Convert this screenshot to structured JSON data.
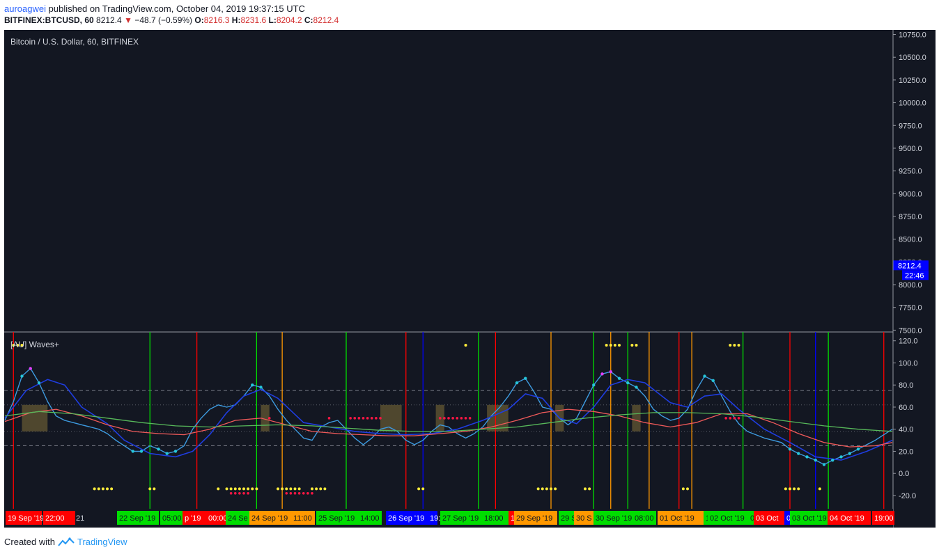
{
  "header": {
    "user": "auroagwei",
    "published": "published on TradingView.com, October 04, 2019 19:37:15 UTC",
    "symbol": "BITFINEX:BTCUSD, 60",
    "last": "8212.4",
    "change": "−48.7 (−0.59%)",
    "o_label": "O:",
    "o": "8216.3",
    "h_label": "H:",
    "h": "8231.6",
    "l_label": "L:",
    "l": "8204.2",
    "c_label": "C:",
    "c": "8212.4"
  },
  "footer": {
    "created": "Created with",
    "brand": "TradingView"
  },
  "colors": {
    "background": "#131722",
    "price_tag": "#0000ff",
    "wave_fast": "#3d9be0",
    "wave_slow": "#1f3de0",
    "red_line": "#f05a5a",
    "green_line": "#57b85a",
    "overbought_dot": "#e040fb",
    "dot_cyan": "#26c6da",
    "dot_yellow": "#ffeb3b",
    "dot_red": "#ff1744",
    "vline_red": "#ff0000",
    "vline_green": "#00dd00",
    "vline_orange": "#ff9800",
    "vline_blue": "#0000ff",
    "zone": "#5a5030"
  },
  "chart_data": [
    {
      "type": "line",
      "title": "Bitcoin / U.S. Dollar, 60, BITFINEX",
      "ylim": [
        7480,
        10800
      ],
      "y_ticks": [
        "10750.0",
        "10500.0",
        "10250.0",
        "10000.0",
        "9750.0",
        "9500.0",
        "9250.0",
        "9000.0",
        "8750.0",
        "8500.0",
        "8250.0",
        "8000.0",
        "7750.0",
        "7500.0"
      ],
      "last_price": "8212.4",
      "countdown": "22:46",
      "series": []
    },
    {
      "type": "line",
      "title": "[AU] Waves+",
      "ylim": [
        -32,
        128
      ],
      "y_ticks": [
        "120.0",
        "100.0",
        "80.0",
        "60.0",
        "40.0",
        "20.0",
        "0.0",
        "-20.0"
      ],
      "ref_levels_dashed": [
        75,
        25
      ],
      "ref_levels_dotted": [
        62,
        38
      ],
      "x_count": 209,
      "series": [
        {
          "name": "wave_fast",
          "points": [
            [
              0,
              48
            ],
            [
              2,
              65
            ],
            [
              4,
              88
            ],
            [
              6,
              95
            ],
            [
              8,
              82
            ],
            [
              10,
              65
            ],
            [
              12,
              52
            ],
            [
              14,
              48
            ],
            [
              16,
              46
            ],
            [
              18,
              44
            ],
            [
              20,
              42
            ],
            [
              22,
              40
            ],
            [
              24,
              36
            ],
            [
              26,
              30
            ],
            [
              28,
              25
            ],
            [
              30,
              20
            ],
            [
              32,
              20
            ],
            [
              34,
              25
            ],
            [
              36,
              22
            ],
            [
              38,
              18
            ],
            [
              40,
              20
            ],
            [
              42,
              25
            ],
            [
              44,
              40
            ],
            [
              46,
              50
            ],
            [
              48,
              58
            ],
            [
              50,
              62
            ],
            [
              52,
              60
            ],
            [
              54,
              62
            ],
            [
              56,
              70
            ],
            [
              58,
              80
            ],
            [
              60,
              78
            ],
            [
              62,
              70
            ],
            [
              64,
              58
            ],
            [
              66,
              48
            ],
            [
              68,
              40
            ],
            [
              70,
              32
            ],
            [
              72,
              30
            ],
            [
              74,
              42
            ],
            [
              76,
              46
            ],
            [
              78,
              48
            ],
            [
              80,
              40
            ],
            [
              82,
              32
            ],
            [
              84,
              26
            ],
            [
              86,
              32
            ],
            [
              88,
              40
            ],
            [
              90,
              42
            ],
            [
              92,
              38
            ],
            [
              94,
              30
            ],
            [
              96,
              26
            ],
            [
              98,
              30
            ],
            [
              100,
              38
            ],
            [
              102,
              44
            ],
            [
              104,
              42
            ],
            [
              106,
              36
            ],
            [
              108,
              32
            ],
            [
              110,
              36
            ],
            [
              112,
              42
            ],
            [
              114,
              52
            ],
            [
              116,
              60
            ],
            [
              118,
              70
            ],
            [
              120,
              82
            ],
            [
              122,
              86
            ],
            [
              124,
              74
            ],
            [
              126,
              60
            ],
            [
              128,
              58
            ],
            [
              130,
              50
            ],
            [
              132,
              44
            ],
            [
              134,
              50
            ],
            [
              136,
              65
            ],
            [
              138,
              80
            ],
            [
              140,
              90
            ],
            [
              142,
              92
            ],
            [
              144,
              86
            ],
            [
              146,
              82
            ],
            [
              148,
              78
            ],
            [
              150,
              70
            ],
            [
              152,
              58
            ],
            [
              154,
              52
            ],
            [
              156,
              48
            ],
            [
              158,
              50
            ],
            [
              160,
              58
            ],
            [
              162,
              75
            ],
            [
              164,
              88
            ],
            [
              166,
              84
            ],
            [
              168,
              70
            ],
            [
              170,
              56
            ],
            [
              172,
              45
            ],
            [
              174,
              38
            ],
            [
              176,
              35
            ],
            [
              178,
              32
            ],
            [
              180,
              30
            ],
            [
              182,
              28
            ],
            [
              184,
              22
            ],
            [
              186,
              18
            ],
            [
              188,
              15
            ],
            [
              190,
              12
            ],
            [
              192,
              8
            ],
            [
              194,
              12
            ],
            [
              196,
              15
            ],
            [
              198,
              18
            ],
            [
              200,
              22
            ],
            [
              202,
              26
            ],
            [
              204,
              30
            ],
            [
              206,
              35
            ],
            [
              208,
              40
            ]
          ]
        },
        {
          "name": "wave_slow",
          "points": [
            [
              0,
              50
            ],
            [
              5,
              75
            ],
            [
              10,
              85
            ],
            [
              14,
              80
            ],
            [
              18,
              60
            ],
            [
              24,
              45
            ],
            [
              28,
              30
            ],
            [
              34,
              18
            ],
            [
              40,
              15
            ],
            [
              44,
              20
            ],
            [
              48,
              35
            ],
            [
              52,
              55
            ],
            [
              56,
              70
            ],
            [
              60,
              76
            ],
            [
              64,
              68
            ],
            [
              70,
              46
            ],
            [
              76,
              42
            ],
            [
              82,
              38
            ],
            [
              88,
              36
            ],
            [
              94,
              35
            ],
            [
              100,
              36
            ],
            [
              106,
              40
            ],
            [
              112,
              48
            ],
            [
              118,
              58
            ],
            [
              122,
              72
            ],
            [
              126,
              68
            ],
            [
              130,
              50
            ],
            [
              134,
              45
            ],
            [
              138,
              60
            ],
            [
              142,
              80
            ],
            [
              146,
              85
            ],
            [
              150,
              82
            ],
            [
              156,
              64
            ],
            [
              160,
              60
            ],
            [
              164,
              70
            ],
            [
              168,
              72
            ],
            [
              172,
              58
            ],
            [
              178,
              40
            ],
            [
              184,
              28
            ],
            [
              190,
              15
            ],
            [
              196,
              12
            ],
            [
              202,
              20
            ],
            [
              208,
              30
            ]
          ]
        },
        {
          "name": "red_line",
          "points": [
            [
              0,
              47
            ],
            [
              6,
              55
            ],
            [
              12,
              58
            ],
            [
              18,
              52
            ],
            [
              24,
              44
            ],
            [
              30,
              38
            ],
            [
              36,
              36
            ],
            [
              42,
              35
            ],
            [
              48,
              40
            ],
            [
              54,
              48
            ],
            [
              60,
              50
            ],
            [
              66,
              44
            ],
            [
              72,
              38
            ],
            [
              78,
              36
            ],
            [
              84,
              35
            ],
            [
              90,
              34
            ],
            [
              96,
              34
            ],
            [
              102,
              36
            ],
            [
              108,
              38
            ],
            [
              114,
              42
            ],
            [
              120,
              48
            ],
            [
              126,
              55
            ],
            [
              132,
              58
            ],
            [
              138,
              56
            ],
            [
              144,
              52
            ],
            [
              150,
              46
            ],
            [
              156,
              42
            ],
            [
              162,
              46
            ],
            [
              168,
              54
            ],
            [
              174,
              54
            ],
            [
              180,
              46
            ],
            [
              186,
              36
            ],
            [
              192,
              28
            ],
            [
              198,
              24
            ],
            [
              204,
              25
            ],
            [
              208,
              28
            ]
          ]
        },
        {
          "name": "green_line",
          "points": [
            [
              0,
              52
            ],
            [
              8,
              56
            ],
            [
              16,
              54
            ],
            [
              24,
              50
            ],
            [
              32,
              46
            ],
            [
              40,
              43
            ],
            [
              48,
              42
            ],
            [
              56,
              43
            ],
            [
              64,
              44
            ],
            [
              72,
              43
            ],
            [
              80,
              41
            ],
            [
              88,
              39
            ],
            [
              96,
              38
            ],
            [
              104,
              38
            ],
            [
              112,
              40
            ],
            [
              120,
              42
            ],
            [
              128,
              46
            ],
            [
              136,
              50
            ],
            [
              144,
              53
            ],
            [
              152,
              55
            ],
            [
              160,
              55
            ],
            [
              168,
              54
            ],
            [
              176,
              51
            ],
            [
              184,
              47
            ],
            [
              192,
              43
            ],
            [
              200,
              40
            ],
            [
              208,
              38
            ]
          ]
        }
      ],
      "x_labels": [
        "19 Sep '19",
        "22:00",
        "21",
        "22 Sep '19",
        "05:00",
        "p '19",
        "00:00",
        "24 Se",
        "24 Sep '19",
        "11:00",
        "25 Sep '19",
        "14:00",
        "26 Sep '19",
        "19:",
        "27 Sep '19",
        "18:00",
        "1:",
        "29 Sep '19",
        "29 S",
        "30 S",
        "30 Sep '19",
        "08:00",
        "01 Oct '19",
        "1",
        "02 Oct '19",
        "0",
        "03 Oct",
        "0",
        "03 Oct '19",
        "04 Oct '19",
        "19:00"
      ]
    }
  ]
}
